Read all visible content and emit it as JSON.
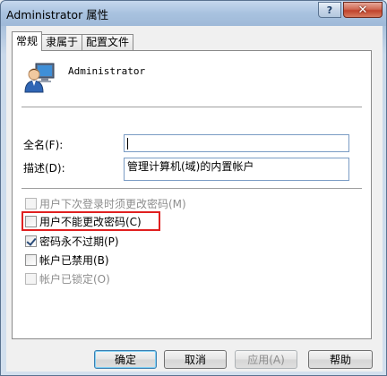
{
  "window": {
    "title": "Administrator 属性",
    "help_label": "?",
    "close_label": "✕"
  },
  "tabs": [
    {
      "label": "常规",
      "active": true
    },
    {
      "label": "隶属于",
      "active": false
    },
    {
      "label": "配置文件",
      "active": false
    }
  ],
  "user": {
    "name": "Administrator",
    "icon": "user-icon"
  },
  "fields": {
    "fullname_label": "全名(F):",
    "fullname_value": "",
    "description_label": "描述(D):",
    "description_value": "管理计算机(域)的内置帐户"
  },
  "checkboxes": [
    {
      "label": "用户下次登录时须更改密码(M)",
      "checked": false,
      "disabled": true
    },
    {
      "label": "用户不能更改密码(C)",
      "checked": false,
      "disabled": false
    },
    {
      "label": "密码永不过期(P)",
      "checked": true,
      "disabled": false
    },
    {
      "label": "帐户已禁用(B)",
      "checked": false,
      "disabled": false
    },
    {
      "label": "帐户已锁定(O)",
      "checked": false,
      "disabled": true
    }
  ],
  "buttons": {
    "ok": "确定",
    "cancel": "取消",
    "apply": "应用(A)",
    "help": "帮助"
  },
  "colors": {
    "highlight": "#e02020"
  }
}
